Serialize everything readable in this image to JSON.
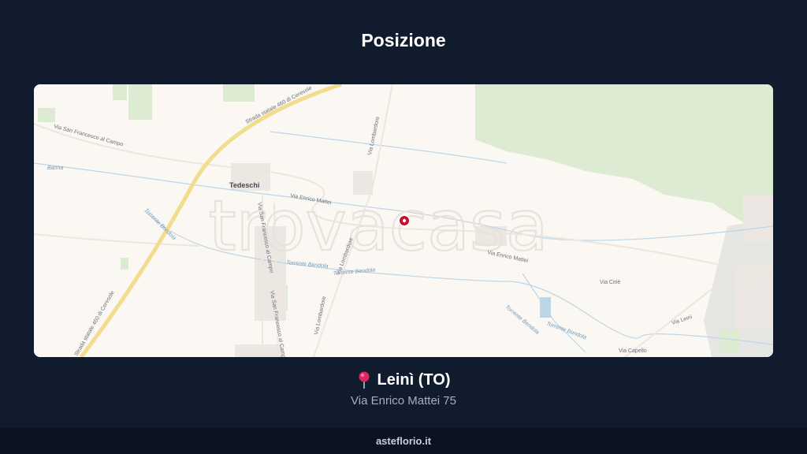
{
  "header": {
    "title": "Posizione"
  },
  "map": {
    "watermark": "trovacasa",
    "town_label": "Tedeschi",
    "road_labels": {
      "sp460": "Strada statale 460 di Ceresole",
      "sp460_lower": "Strada statale 460 di Ceresole",
      "san_francesco": "Via San Francesco al Campo",
      "san_francesco_v": "Via San Francesco al Campo",
      "san_francesco_v2": "Via San Francesco al Campo",
      "lombardore_top": "Via Lombardore",
      "lombardore_mid": "Via Lombardore",
      "lombardore_bottom": "Via Lombardore",
      "mattei": "Via Enrico Mattei",
      "mattei_right": "Via Enrico Mattei",
      "cirie": "Via Ciriè",
      "leini": "Via Leinì",
      "capello": "Via Capello"
    },
    "water_labels": {
      "banna": "Banna",
      "bendola_1": "Torrente Bendola",
      "bendola_2": "Torrente Bendola",
      "bendola_3": "Torrente Bendola",
      "bendola_4": "Torrente Bendola",
      "bendola_5": "Torrente Bendola"
    },
    "marker": {
      "icon": "location-marker-icon",
      "color": "#c8102e"
    },
    "colors": {
      "land": "#fbf7f3",
      "green": "#dcebd2",
      "road_major": "#f2dc8e",
      "water": "#bcd6e8"
    }
  },
  "location": {
    "pin_icon": "round-pushpin-icon",
    "name": "Leinì (TO)",
    "address": "Via Enrico Mattei 75"
  },
  "footer": {
    "brand": "asteflorio.it"
  }
}
